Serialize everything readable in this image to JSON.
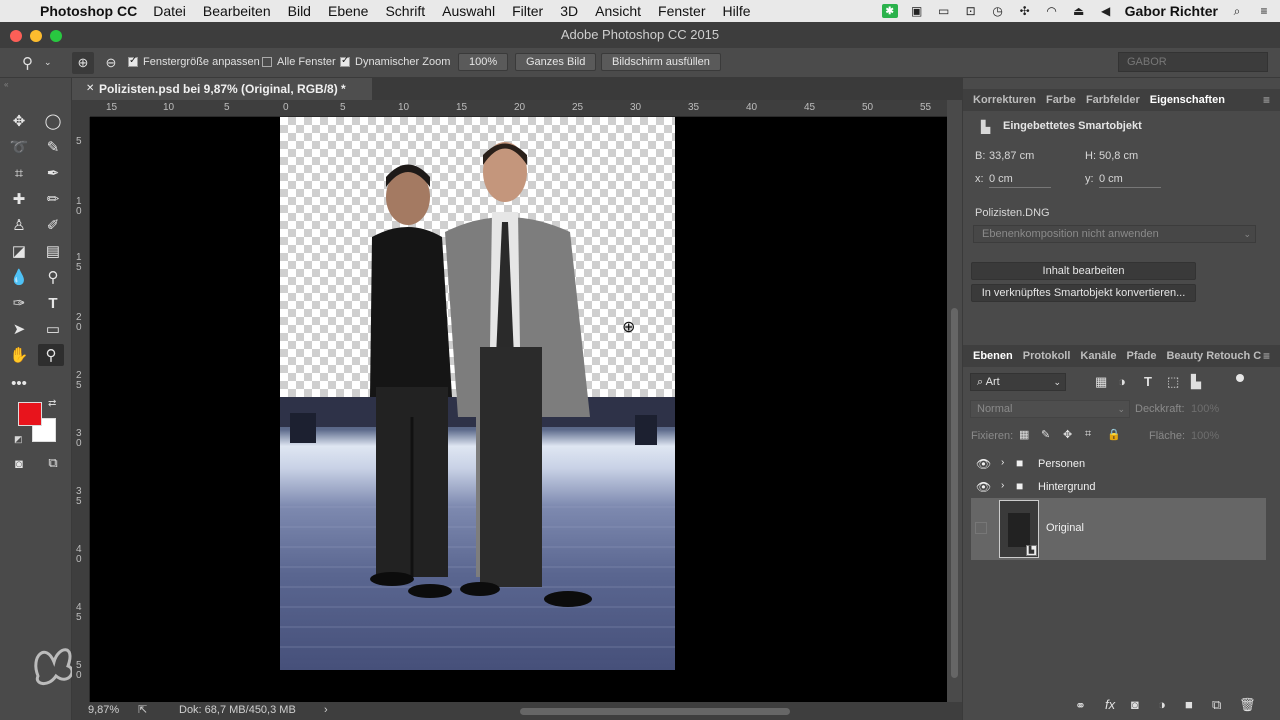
{
  "menubar": {
    "app_name": "Photoshop CC",
    "items": [
      "Datei",
      "Bearbeiten",
      "Bild",
      "Ebene",
      "Schrift",
      "Auswahl",
      "Filter",
      "3D",
      "Ansicht",
      "Fenster",
      "Hilfe"
    ],
    "user": "Gabor Richter"
  },
  "window": {
    "title": "Adobe Photoshop CC 2015"
  },
  "options": {
    "fit_window": "Fenstergröße anpassen",
    "all_windows": "Alle Fenster",
    "scrubby_zoom": "Dynamischer Zoom",
    "zoom_pct": "100%",
    "fit_screen": "Ganzes Bild",
    "fill_screen": "Bildschirm ausfüllen",
    "workspace": "GABOR"
  },
  "document": {
    "tab_title": "Polizisten.psd bei 9,87% (Original, RGB/8) *",
    "ruler_h": [
      "15",
      "10",
      "5",
      "0",
      "5",
      "10",
      "15",
      "20",
      "25",
      "30",
      "35",
      "40",
      "45",
      "50",
      "55"
    ],
    "ruler_v": [
      "5",
      "1\n0",
      "1\n5",
      "2\n0",
      "2\n5",
      "3\n0",
      "3\n5",
      "4\n0",
      "4\n5",
      "5\n0"
    ]
  },
  "status": {
    "zoom": "9,87%",
    "doc_size": "Dok: 68,7 MB/450,3 MB"
  },
  "properties": {
    "tabs": [
      "Korrekturen",
      "Farbe",
      "Farbfelder",
      "Eigenschaften"
    ],
    "active_tab": "Eigenschaften",
    "object_type": "Eingebettetes Smartobjekt",
    "width_label": "B:",
    "width_value": "33,87 cm",
    "height_label": "H:",
    "height_value": "50,8 cm",
    "x_label": "x:",
    "x_value": "0 cm",
    "y_label": "y:",
    "y_value": "0 cm",
    "source_file": "Polizisten.DNG",
    "layer_comp": "Ebenenkomposition nicht anwenden",
    "edit_contents": "Inhalt bearbeiten",
    "convert_linked": "In verknüpftes Smartobjekt konvertieren..."
  },
  "layers_panel": {
    "tabs": [
      "Ebenen",
      "Protokoll",
      "Kanäle",
      "Pfade",
      "Beauty Retouch C"
    ],
    "active_tab": "Ebenen",
    "filter_kind": "Art",
    "blend_mode": "Normal",
    "opacity_label": "Deckkraft:",
    "opacity_value": "100%",
    "lock_label": "Fixieren:",
    "fill_label": "Fläche:",
    "fill_value": "100%",
    "layers": [
      {
        "name": "Personen",
        "type": "group",
        "visible": true
      },
      {
        "name": "Hintergrund",
        "type": "group",
        "visible": true
      },
      {
        "name": "Original",
        "type": "smart-object",
        "visible": false,
        "selected": true
      }
    ]
  },
  "colors": {
    "foreground": "#e8141c",
    "background": "#ffffff"
  }
}
